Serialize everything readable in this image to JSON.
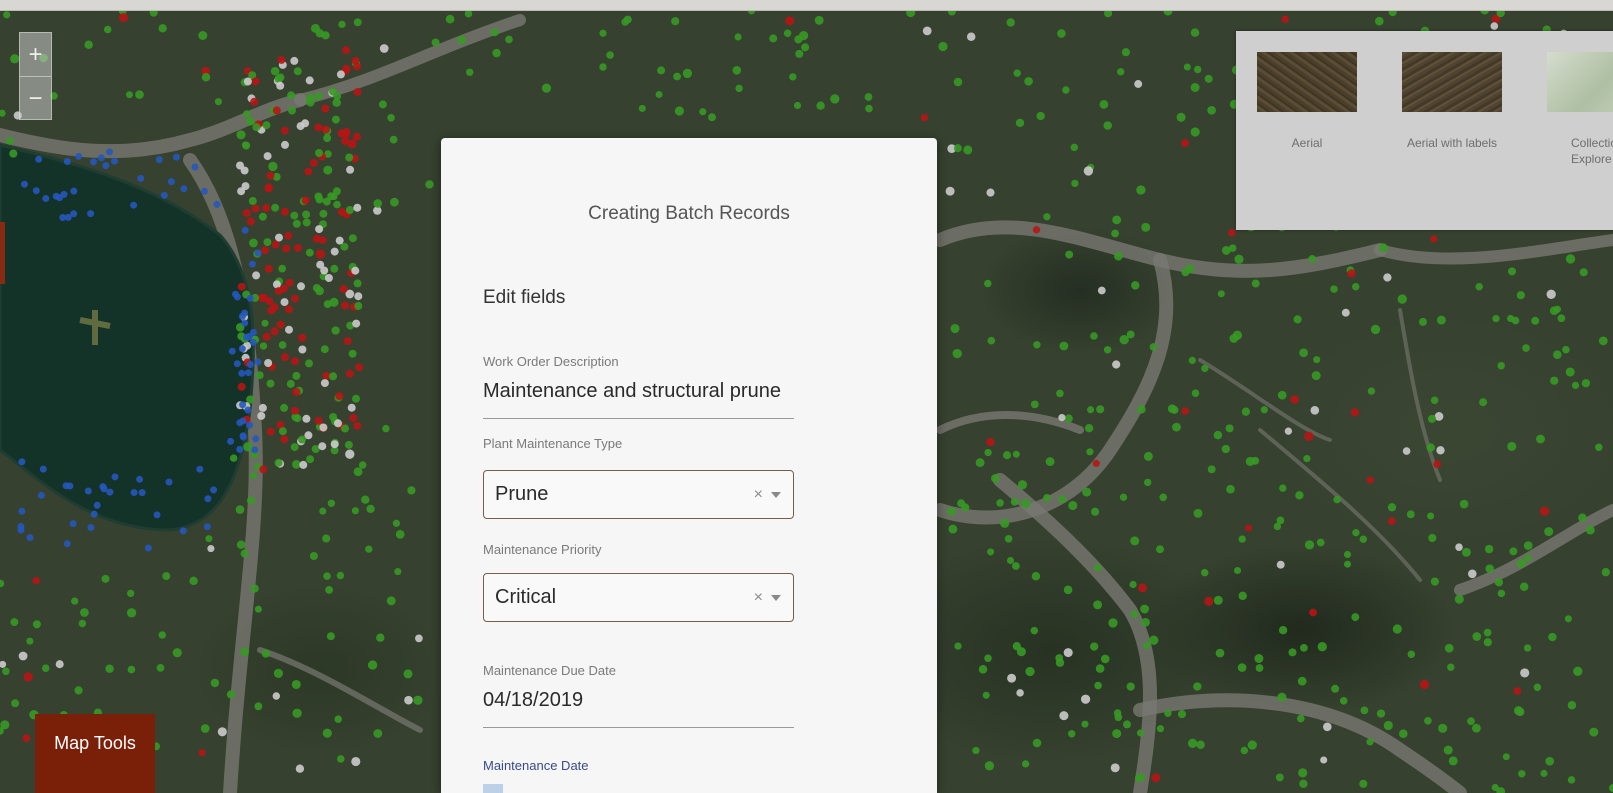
{
  "map": {
    "zoom_in": "+",
    "zoom_out": "−",
    "map_tools_label": "Map Tools"
  },
  "basemaps": [
    {
      "label": "Aerial"
    },
    {
      "label": "Aerial with labels"
    },
    {
      "label": "Collectio\nExplore"
    }
  ],
  "dialog": {
    "title": "Creating Batch Records",
    "section": "Edit fields",
    "fields": {
      "work_order_description": {
        "label": "Work Order Description",
        "value": "Maintenance and structural prune"
      },
      "plant_maintenance_type": {
        "label": "Plant Maintenance Type",
        "value": "Prune"
      },
      "maintenance_priority": {
        "label": "Maintenance Priority",
        "value": "Critical"
      },
      "maintenance_due_date": {
        "label": "Maintenance Due Date",
        "value": "04/18/2019"
      },
      "maintenance_date": {
        "label": "Maintenance Date"
      }
    },
    "clear_glyph": "×"
  },
  "colors": {
    "accent_dark_red": "#7a1f08",
    "point_green": "#3fae2a",
    "point_red": "#d01818",
    "point_blue": "#2a64d6",
    "point_white": "#e8e8e8"
  }
}
